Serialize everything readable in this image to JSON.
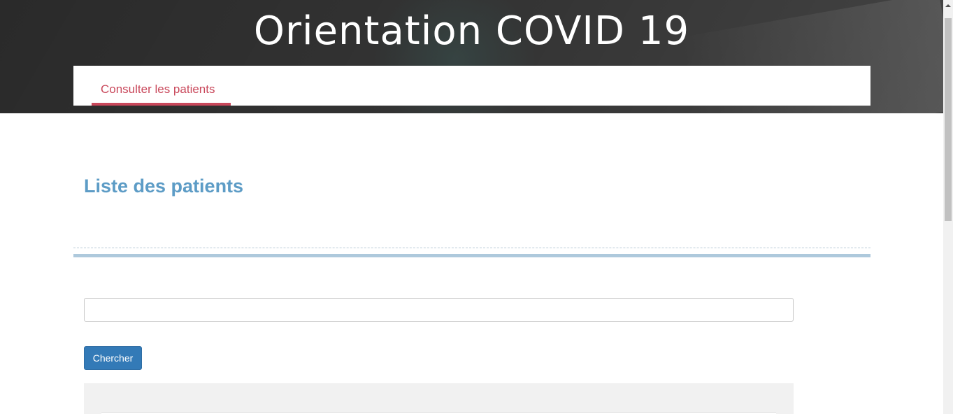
{
  "header": {
    "site_title": "Orientation COVID 19"
  },
  "nav": {
    "tabs": [
      {
        "label": "Consulter les patients",
        "active": true
      }
    ]
  },
  "main": {
    "heading": "Liste des patients",
    "search": {
      "value": "",
      "placeholder": ""
    },
    "search_button_label": "Chercher"
  },
  "colors": {
    "nav_active": "#c9485b",
    "heading": "#5d9cc6",
    "divider": "#aec9dc",
    "primary_button": "#337ab7",
    "panel_background": "#f1f1f1"
  }
}
